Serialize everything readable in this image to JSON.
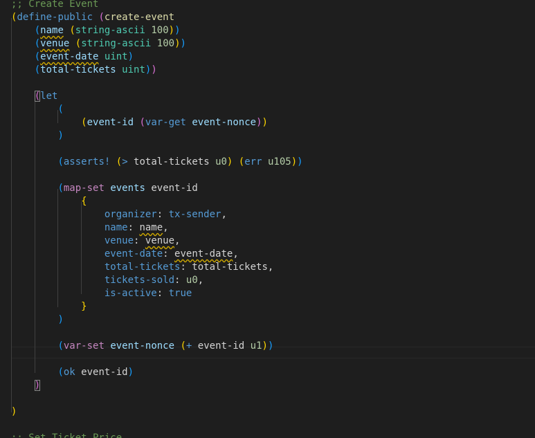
{
  "editor": {
    "lines": [
      {
        "indent": 0,
        "tokens": [
          {
            "t": ";; Create Event",
            "c": "comment"
          }
        ]
      },
      {
        "indent": 0,
        "tokens": [
          {
            "t": "(",
            "c": "b1"
          },
          {
            "t": "define-public",
            "c": "keyword"
          },
          {
            "t": " ",
            "c": "plain"
          },
          {
            "t": "(",
            "c": "b2"
          },
          {
            "t": "create-event",
            "c": "fn"
          }
        ]
      },
      {
        "indent": 4,
        "tokens": [
          {
            "t": "(",
            "c": "b3"
          },
          {
            "t": "name",
            "c": "param",
            "sq": true
          },
          {
            "t": " ",
            "c": "plain"
          },
          {
            "t": "(",
            "c": "b1"
          },
          {
            "t": "string-ascii",
            "c": "type"
          },
          {
            "t": " ",
            "c": "plain"
          },
          {
            "t": "100",
            "c": "num"
          },
          {
            "t": ")",
            "c": "b1"
          },
          {
            "t": ")",
            "c": "b3"
          }
        ]
      },
      {
        "indent": 4,
        "tokens": [
          {
            "t": "(",
            "c": "b3"
          },
          {
            "t": "venue",
            "c": "param",
            "sq": true
          },
          {
            "t": " ",
            "c": "plain"
          },
          {
            "t": "(",
            "c": "b1"
          },
          {
            "t": "string-ascii",
            "c": "type"
          },
          {
            "t": " ",
            "c": "plain"
          },
          {
            "t": "100",
            "c": "num"
          },
          {
            "t": ")",
            "c": "b1"
          },
          {
            "t": ")",
            "c": "b3"
          }
        ]
      },
      {
        "indent": 4,
        "tokens": [
          {
            "t": "(",
            "c": "b3"
          },
          {
            "t": "event-date",
            "c": "param",
            "sq": true
          },
          {
            "t": " ",
            "c": "plain"
          },
          {
            "t": "uint",
            "c": "type"
          },
          {
            "t": ")",
            "c": "b3"
          }
        ]
      },
      {
        "indent": 4,
        "tokens": [
          {
            "t": "(",
            "c": "b3"
          },
          {
            "t": "total-tickets",
            "c": "param"
          },
          {
            "t": " ",
            "c": "plain"
          },
          {
            "t": "uint",
            "c": "type"
          },
          {
            "t": ")",
            "c": "b3"
          },
          {
            "t": ")",
            "c": "b2"
          }
        ]
      },
      {
        "indent": 0,
        "tokens": []
      },
      {
        "indent": 4,
        "tokens": [
          {
            "t": "(",
            "c": "b2",
            "box": true
          },
          {
            "t": "let",
            "c": "keyword"
          }
        ]
      },
      {
        "indent": 8,
        "tokens": [
          {
            "t": "(",
            "c": "b3"
          }
        ]
      },
      {
        "indent": 12,
        "tokens": [
          {
            "t": "(",
            "c": "b1"
          },
          {
            "t": "event-id",
            "c": "param"
          },
          {
            "t": " ",
            "c": "plain"
          },
          {
            "t": "(",
            "c": "b2"
          },
          {
            "t": "var-get",
            "c": "keyword"
          },
          {
            "t": " ",
            "c": "plain"
          },
          {
            "t": "event-nonce",
            "c": "param"
          },
          {
            "t": ")",
            "c": "b2"
          },
          {
            "t": ")",
            "c": "b1"
          }
        ]
      },
      {
        "indent": 8,
        "tokens": [
          {
            "t": ")",
            "c": "b3"
          }
        ]
      },
      {
        "indent": 0,
        "tokens": []
      },
      {
        "indent": 8,
        "tokens": [
          {
            "t": "(",
            "c": "b3"
          },
          {
            "t": "asserts!",
            "c": "keyword"
          },
          {
            "t": " ",
            "c": "plain"
          },
          {
            "t": "(",
            "c": "b1"
          },
          {
            "t": ">",
            "c": "keyword"
          },
          {
            "t": " total-tickets ",
            "c": "plain"
          },
          {
            "t": "u0",
            "c": "num"
          },
          {
            "t": ")",
            "c": "b1"
          },
          {
            "t": " ",
            "c": "plain"
          },
          {
            "t": "(",
            "c": "b1"
          },
          {
            "t": "err",
            "c": "keyword"
          },
          {
            "t": " ",
            "c": "plain"
          },
          {
            "t": "u105",
            "c": "num"
          },
          {
            "t": ")",
            "c": "b1"
          },
          {
            "t": ")",
            "c": "b3"
          }
        ]
      },
      {
        "indent": 0,
        "tokens": []
      },
      {
        "indent": 8,
        "tokens": [
          {
            "t": "(",
            "c": "b3"
          },
          {
            "t": "map-set",
            "c": "keyword2"
          },
          {
            "t": " ",
            "c": "plain"
          },
          {
            "t": "events",
            "c": "param"
          },
          {
            "t": " event-id",
            "c": "plain"
          }
        ]
      },
      {
        "indent": 12,
        "tokens": [
          {
            "t": "{",
            "c": "b1"
          }
        ]
      },
      {
        "indent": 16,
        "tokens": [
          {
            "t": "organizer",
            "c": "keyword"
          },
          {
            "t": ": ",
            "c": "plain"
          },
          {
            "t": "tx-sender",
            "c": "keyword"
          },
          {
            "t": ",",
            "c": "plain"
          }
        ]
      },
      {
        "indent": 16,
        "tokens": [
          {
            "t": "name",
            "c": "keyword"
          },
          {
            "t": ": ",
            "c": "plain"
          },
          {
            "t": "name",
            "c": "plain",
            "sq": true
          },
          {
            "t": ",",
            "c": "plain"
          }
        ]
      },
      {
        "indent": 16,
        "tokens": [
          {
            "t": "venue",
            "c": "keyword"
          },
          {
            "t": ": ",
            "c": "plain"
          },
          {
            "t": "venue",
            "c": "plain",
            "sq": true
          },
          {
            "t": ",",
            "c": "plain"
          }
        ]
      },
      {
        "indent": 16,
        "tokens": [
          {
            "t": "event-date",
            "c": "keyword"
          },
          {
            "t": ": ",
            "c": "plain"
          },
          {
            "t": "event-date",
            "c": "plain",
            "sq": true
          },
          {
            "t": ",",
            "c": "plain"
          }
        ]
      },
      {
        "indent": 16,
        "tokens": [
          {
            "t": "total-tickets",
            "c": "keyword"
          },
          {
            "t": ": total-tickets,",
            "c": "plain"
          }
        ]
      },
      {
        "indent": 16,
        "tokens": [
          {
            "t": "tickets-sold",
            "c": "keyword"
          },
          {
            "t": ": ",
            "c": "plain"
          },
          {
            "t": "u0",
            "c": "num"
          },
          {
            "t": ",",
            "c": "plain"
          }
        ]
      },
      {
        "indent": 16,
        "tokens": [
          {
            "t": "is-active",
            "c": "keyword"
          },
          {
            "t": ": ",
            "c": "plain"
          },
          {
            "t": "true",
            "c": "bool"
          }
        ]
      },
      {
        "indent": 12,
        "tokens": [
          {
            "t": "}",
            "c": "b1"
          }
        ]
      },
      {
        "indent": 8,
        "tokens": [
          {
            "t": ")",
            "c": "b3"
          }
        ]
      },
      {
        "indent": 0,
        "tokens": []
      },
      {
        "indent": 8,
        "tokens": [
          {
            "t": "(",
            "c": "b3"
          },
          {
            "t": "var-set",
            "c": "keyword2"
          },
          {
            "t": " ",
            "c": "plain"
          },
          {
            "t": "event-nonce",
            "c": "param"
          },
          {
            "t": " ",
            "c": "plain"
          },
          {
            "t": "(",
            "c": "b1"
          },
          {
            "t": "+",
            "c": "keyword"
          },
          {
            "t": " event-id ",
            "c": "plain"
          },
          {
            "t": "u1",
            "c": "num"
          },
          {
            "t": ")",
            "c": "b1"
          },
          {
            "t": ")",
            "c": "b3"
          }
        ]
      },
      {
        "indent": 0,
        "tokens": []
      },
      {
        "indent": 8,
        "tokens": [
          {
            "t": "(",
            "c": "b3"
          },
          {
            "t": "ok",
            "c": "keyword"
          },
          {
            "t": " event-id",
            "c": "plain"
          },
          {
            "t": ")",
            "c": "b3"
          }
        ]
      },
      {
        "indent": 4,
        "tokens": [
          {
            "t": ")",
            "c": "b2",
            "box": true
          }
        ]
      },
      {
        "indent": 0,
        "tokens": []
      },
      {
        "indent": 0,
        "tokens": [
          {
            "t": ")",
            "c": "b1"
          }
        ]
      },
      {
        "indent": 0,
        "tokens": []
      },
      {
        "indent": 0,
        "tokens": [
          {
            "t": ";; Set Ticket Price",
            "c": "comment"
          }
        ]
      }
    ],
    "colors": {
      "background": "#1e1e1e",
      "comment": "#6a9955",
      "keyword": "#569cd6",
      "keyword2": "#c586c0",
      "function": "#dcdcaa",
      "parameter": "#9cdcfe",
      "type": "#4ec9b0",
      "number": "#b5cea8",
      "bracket_gold": "#ffd700",
      "bracket_orchid": "#da70d6",
      "bracket_blue": "#179fff"
    }
  }
}
